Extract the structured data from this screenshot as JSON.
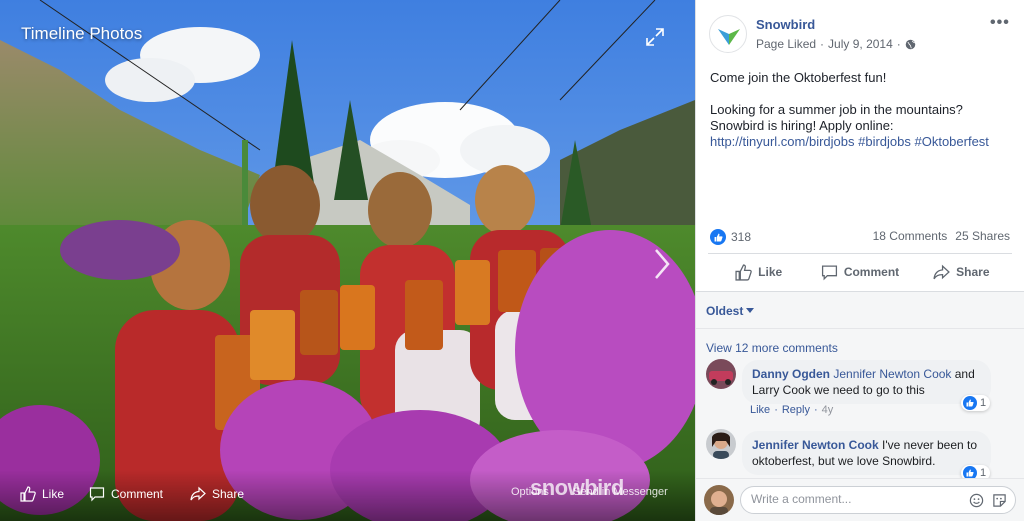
{
  "photo": {
    "title": "Timeline Photos",
    "watermark": "snowbird",
    "actions": {
      "like": "Like",
      "comment": "Comment",
      "share": "Share"
    },
    "options_label": "Options",
    "messenger_label": "Send in Messenger"
  },
  "post": {
    "page_name": "Snowbird",
    "status": "Page Liked",
    "date": "July 9, 2014",
    "line1": "Come join the Oktoberfest fun!",
    "line2": "Looking for a summer job in the mountains? Snowbird is hiring! Apply online: ",
    "link": "http://tinyurl.com/birdjobs",
    "hashtags": " #birdjobs #Oktoberfest",
    "reaction_count": "318",
    "comments_count": "18 Comments",
    "shares_count": "25 Shares",
    "actions": {
      "like": "Like",
      "comment": "Comment",
      "share": "Share"
    }
  },
  "comments": {
    "sort": "Oldest",
    "view_more": "View 12 more comments",
    "items": [
      {
        "author": "Danny Ogden",
        "tag": "Jennifer Newton Cook",
        "text": " and Larry Cook we need to go to this",
        "reactions": "1",
        "like": "Like",
        "reply": "Reply",
        "time": "4y"
      },
      {
        "author": "Jennifer Newton Cook",
        "text": " I've never been to oktoberfest, but we love Snowbird.",
        "reactions": "1"
      }
    ],
    "write_placeholder": "Write a comment..."
  },
  "colors": {
    "link": "#385898",
    "like_blue": "#1877f2",
    "text": "#1d2129",
    "muted": "#606770"
  },
  "icons": [
    "expand-icon",
    "next-arrow-icon",
    "like-icon",
    "comment-icon",
    "share-icon",
    "globe-icon",
    "more-icon",
    "caret-down-icon",
    "emoji-icon",
    "sticker-icon"
  ]
}
